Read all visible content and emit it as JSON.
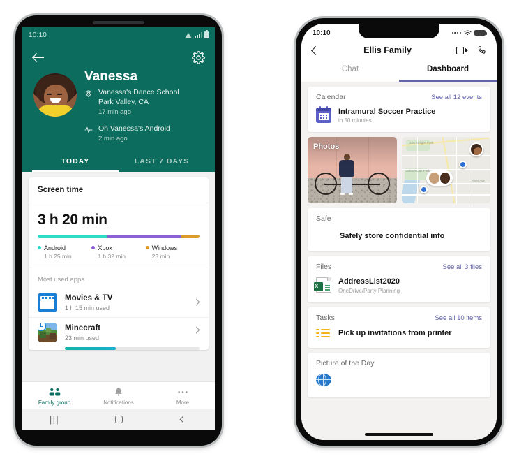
{
  "left_phone": {
    "platform": "android",
    "status_bar": {
      "time": "10:10",
      "icons": [
        "wifi-icon",
        "signal-icon",
        "battery-icon"
      ]
    },
    "header": {
      "back_icon": "back-arrow-icon",
      "settings_icon": "gear-icon",
      "name": "Vanessa",
      "location_icon": "location-pin-icon",
      "location_line1": "Vanessa's Dance School",
      "location_line2": "Park Valley, CA",
      "location_time": "17 min ago",
      "activity_icon": "activity-pulse-icon",
      "activity_line": "On Vanessa's Android",
      "activity_time": "2 min ago",
      "accent_color": "#0c6d5e"
    },
    "tabs": [
      {
        "label": "TODAY",
        "active": true
      },
      {
        "label": "LAST 7 DAYS",
        "active": false
      }
    ],
    "screen_time": {
      "card_title": "Screen time",
      "total": "3 h 20 min",
      "segments": [
        {
          "label": "Android",
          "value": "1 h 25 min",
          "color": "#2edcc5",
          "pct": 43
        },
        {
          "label": "Xbox",
          "value": "1 h 32 min",
          "color": "#8b5fd6",
          "pct": 46
        },
        {
          "label": "Windows",
          "value": "23 min",
          "color": "#dd9a2b",
          "pct": 11
        }
      ]
    },
    "most_used": {
      "heading": "Most used apps",
      "apps": [
        {
          "name": "Movies & TV",
          "sub": "1 h 15 min used",
          "icon": "movies-tv-icon",
          "progress": null
        },
        {
          "name": "Minecraft",
          "sub": "23 min used",
          "icon": "minecraft-icon",
          "progress": 38
        }
      ]
    },
    "bottom_nav": [
      {
        "label": "Family group",
        "icon": "family-group-icon",
        "active": true
      },
      {
        "label": "Notifications",
        "icon": "bell-icon",
        "active": false
      },
      {
        "label": "More",
        "icon": "ellipsis-icon",
        "active": false
      }
    ],
    "system_nav": [
      "recents-icon",
      "home-icon",
      "back-icon"
    ]
  },
  "right_phone": {
    "platform": "ios",
    "status_bar": {
      "time": "10:10",
      "icons": [
        "cellular-dots-icon",
        "wifi-icon",
        "battery-icon"
      ]
    },
    "header": {
      "back_icon": "back-chevron-icon",
      "title": "Ellis Family",
      "video_icon": "video-call-icon",
      "phone_icon": "phone-call-icon"
    },
    "tabs": [
      {
        "label": "Chat",
        "active": false
      },
      {
        "label": "Dashboard",
        "active": true
      }
    ],
    "accent_color": "#6264a7",
    "cards": {
      "calendar": {
        "title": "Calendar",
        "link": "See all 12 events",
        "icon": "calendar-icon",
        "item_title": "Intramural Soccer Practice",
        "item_sub": "in 50 minutes"
      },
      "photos": {
        "label": "Photos",
        "alt": "person-with-bicycle-photo"
      },
      "map": {
        "alt": "map-with-people-pins",
        "labels": [
          "Los Amigos Park",
          "Golden Oak Park",
          "River Ave",
          "Pine Ln"
        ]
      },
      "safe": {
        "title": "Safe",
        "icon": "shield-key-icon",
        "item_title": "Safely store confidential info"
      },
      "files": {
        "title": "Files",
        "link": "See all 3 files",
        "icon": "excel-file-icon",
        "item_title": "AddressList2020",
        "item_sub": "OneDrive/Party Planning"
      },
      "tasks": {
        "title": "Tasks",
        "link": "See all 10 items",
        "icon": "tasks-list-icon",
        "item_title": "Pick up invitations from printer"
      },
      "picture_of_day": {
        "title": "Picture of the Day",
        "icon": "globe-icon"
      }
    }
  }
}
